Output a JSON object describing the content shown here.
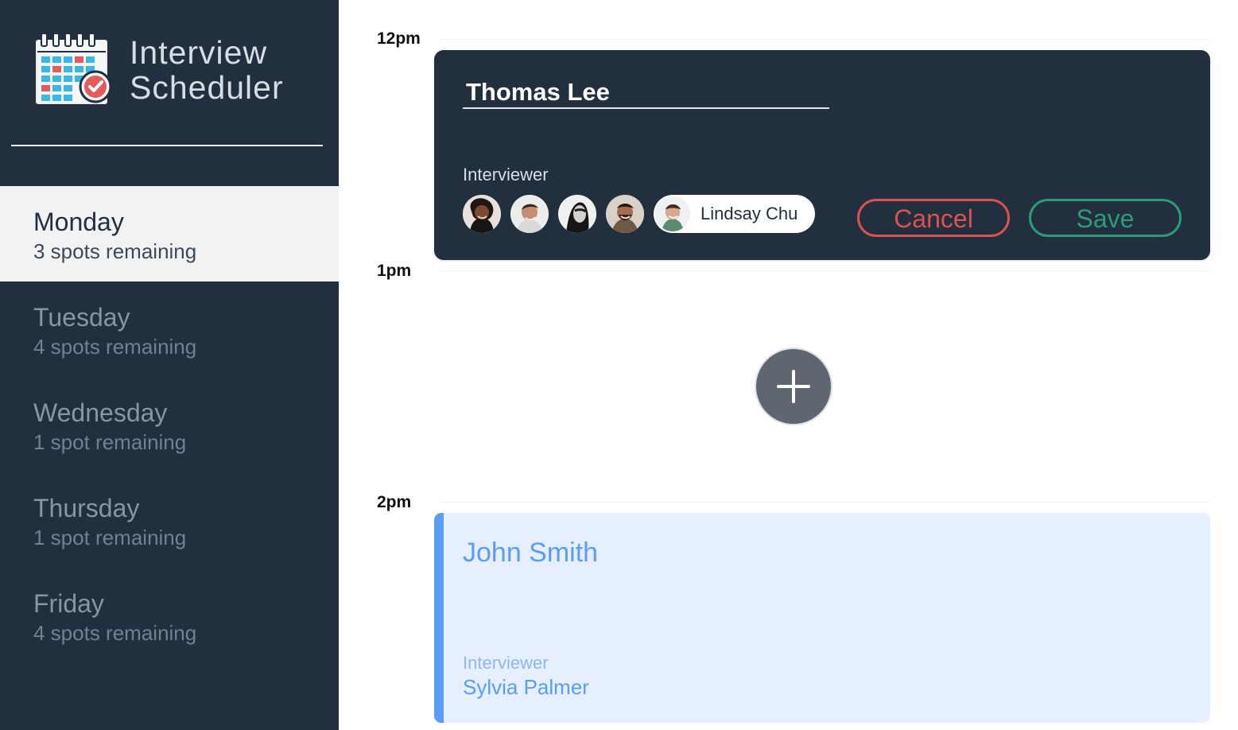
{
  "sidebar": {
    "app_title_line_1": "Interview",
    "app_title_line_2": "Scheduler",
    "logo_icon": "calendar-check-icon",
    "days": [
      {
        "name": "Monday",
        "spots": "3 spots remaining",
        "selected": true
      },
      {
        "name": "Tuesday",
        "spots": "4 spots remaining",
        "selected": false
      },
      {
        "name": "Wednesday",
        "spots": "1 spot remaining",
        "selected": false
      },
      {
        "name": "Thursday",
        "spots": "1 spot remaining",
        "selected": false
      },
      {
        "name": "Friday",
        "spots": "4 spots remaining",
        "selected": false
      }
    ]
  },
  "schedule": {
    "times": {
      "noon": "12pm",
      "one": "1pm",
      "two": "2pm"
    },
    "edit_appointment": {
      "student_name": "Thomas Lee",
      "interviewer_label": "Interviewer",
      "selected_interviewer": "Lindsay Chu",
      "interviewer_avatar_icons": [
        "person-avatar-icon",
        "person-avatar-icon",
        "person-avatar-icon",
        "person-avatar-icon",
        "person-avatar-icon"
      ],
      "cancel_label": "Cancel",
      "save_label": "Save"
    },
    "add_button_icon": "plus-icon",
    "booked_appointment": {
      "student_name": "John Smith",
      "interviewer_label": "Interviewer",
      "interviewer_name": "Sylvia Palmer"
    }
  },
  "colors": {
    "sidebar_background": "#222f3e",
    "selected_day_background": "#f2f2f2",
    "cancel_red": "#d9534f",
    "save_green": "#2d9a79",
    "booked_blue": "#5a9df6",
    "booked_background": "#e5efff"
  }
}
